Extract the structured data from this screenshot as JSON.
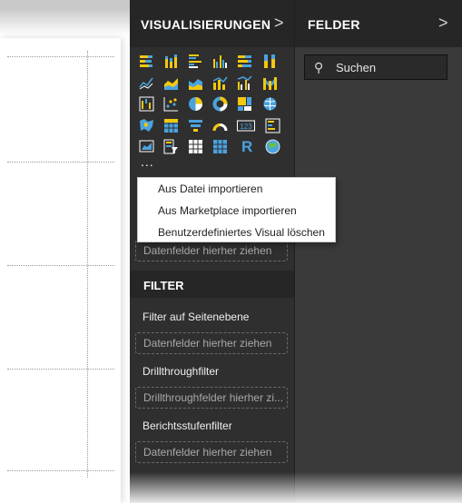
{
  "visualizations_pane": {
    "title": "VISUALISIERUNGEN",
    "chevron": ">",
    "more": "...",
    "icons": [
      "stacked-bar-icon",
      "stacked-column-icon",
      "clustered-bar-icon",
      "clustered-column-icon",
      "100-stacked-bar-icon",
      "100-stacked-column-icon",
      "line-chart-icon",
      "area-chart-icon",
      "stacked-area-icon",
      "line-column-icon",
      "line-clustered-column-icon",
      "ribbon-chart-icon",
      "waterfall-icon",
      "scatter-icon",
      "pie-icon",
      "donut-icon",
      "treemap-icon",
      "map-icon",
      "filled-map-icon",
      "table-matrix-icon",
      "funnel-icon",
      "gauge-icon",
      "card-icon",
      "multi-row-card-icon",
      "kpi-icon",
      "slicer-icon",
      "table-icon",
      "matrix-icon",
      "r-visual-icon",
      "globe-icon"
    ]
  },
  "context_menu": {
    "items": [
      "Aus Datei importieren",
      "Aus Marketplace importieren",
      "Benutzerdefiniertes Visual löschen"
    ]
  },
  "values_dropzone": "Datenfelder hierher ziehen",
  "filter": {
    "title": "FILTER",
    "page_level_label": "Filter auf Seitenebene",
    "page_level_dropzone": "Datenfelder hierher ziehen",
    "drillthrough_label": "Drillthroughfilter",
    "drillthrough_dropzone": "Drillthroughfelder hierher zi...",
    "report_level_label": "Berichtsstufenfilter",
    "report_level_dropzone": "Datenfelder hierher ziehen"
  },
  "fields_pane": {
    "title": "FELDER",
    "chevron": ">",
    "search_placeholder": "Suchen"
  },
  "colors": {
    "icon_yellow": "#f2c811",
    "icon_blue": "#4aa3df",
    "icon_white": "#ffffff",
    "pane_dark": "#2f2f2f",
    "header_dark": "#262626"
  }
}
